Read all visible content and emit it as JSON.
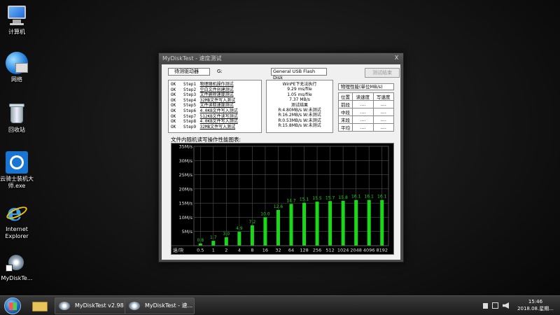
{
  "desktop": {
    "icons": [
      {
        "label": "计算机"
      },
      {
        "label": "网络"
      },
      {
        "label": "回收站"
      },
      {
        "label": "云骑士装机大师.exe"
      },
      {
        "label": "Internet Explorer"
      },
      {
        "label": "MyDiskTe..."
      }
    ]
  },
  "window": {
    "title": "MyDiskTest - 速度测试",
    "close": "X",
    "drive_label": "待测驱动器",
    "drive_letter": "G:",
    "drive_name": "General USB Flash Disk",
    "stop_button": "测试结束",
    "steps": [
      {
        "status": "OK",
        "step": "Step1",
        "desc": "物理随机操作测试"
      },
      {
        "status": "OK",
        "step": "Step2",
        "desc": "空白文件创建测试"
      },
      {
        "status": "OK",
        "step": "Step3",
        "desc": "文件删除速度测试"
      },
      {
        "status": "OK",
        "step": "Step4",
        "desc": "32MB文件写入测试"
      },
      {
        "status": "OK",
        "step": "Step5",
        "desc": "文件读取速度测试"
      },
      {
        "status": "OK",
        "step": "Step6",
        "desc": "4.0KB文件写入测试"
      },
      {
        "status": "OK",
        "step": "Step7",
        "desc": "512KB文件读写测试"
      },
      {
        "status": "OK",
        "step": "Step8",
        "desc": "4.0KB文件写入测试"
      },
      {
        "status": "OK",
        "step": "Step9",
        "desc": "32MB文件写入测试"
      }
    ],
    "results": [
      "WinPE下无法执行",
      "9.29 ms/file",
      "1.05 ms/file",
      "7.37 MB/s",
      "测试结果",
      "R:4.80MB/s W:未测试",
      "R:16.2MB/s W:未测试",
      "R:0.53MB/s W:未测试",
      "R:15.8MB/s W:未测试"
    ],
    "physical": {
      "title": "物理性能(单位MB/s)",
      "headers": [
        "位置",
        "读速度",
        "写速度"
      ],
      "rows": [
        {
          "pos": "前段",
          "read": "....",
          "write": "...."
        },
        {
          "pos": "中段",
          "read": "....",
          "write": "...."
        },
        {
          "pos": "末段",
          "read": "....",
          "write": "...."
        },
        {
          "pos": "平均",
          "read": "....",
          "write": "...."
        }
      ]
    },
    "chart_title": "文件内随机读写操作性能图表:"
  },
  "chart_data": {
    "type": "bar",
    "categories": [
      "0.5",
      "1",
      "2",
      "4",
      "8",
      "16",
      "32",
      "64",
      "128",
      "256",
      "512",
      "1024",
      "2048",
      "4096",
      "8192"
    ],
    "values": [
      0.8,
      1.7,
      3.0,
      4.9,
      7.2,
      10.0,
      12.6,
      14.7,
      15.1,
      15.5,
      15.7,
      15.8,
      16.1,
      16.1,
      16.1
    ],
    "value_labels": [
      "0.8",
      "1.7",
      "3.0",
      "4.9",
      "7.2",
      "10.0",
      "12.6",
      "14.7",
      "15.1",
      "15.5",
      "15.7",
      "15.8",
      "16.1",
      "16.1",
      "16.1"
    ],
    "y_ticks": [
      "5M/s",
      "10M/s",
      "15M/s",
      "20M/s",
      "25M/s",
      "30M/s",
      "35M/s"
    ],
    "ylabel": "速/块",
    "ylim": [
      0,
      35
    ],
    "grid": true,
    "bar_color": "#18d818",
    "label_color": "#18d818"
  },
  "taskbar": {
    "buttons": [
      {
        "label": "MyDiskTest v2.98"
      },
      {
        "label": "MyDiskTest - 速..."
      }
    ],
    "clock_time": "15:46",
    "clock_date": "2018.08.星期..."
  }
}
